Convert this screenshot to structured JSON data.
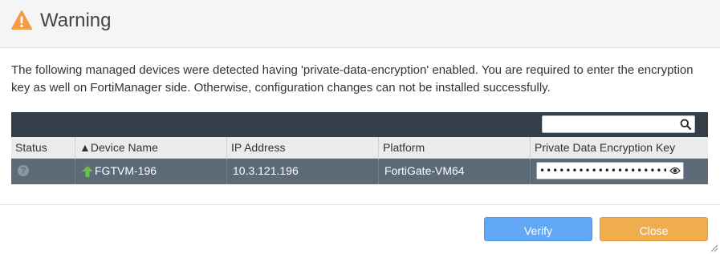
{
  "dialog": {
    "title": "Warning",
    "message": "The following managed devices were detected having 'private-data-encryption' enabled. You are required to enter the encryption key as well on FortiManager side. Otherwise, configuration changes can not be installed successfully."
  },
  "grid": {
    "search": {
      "value": "",
      "placeholder": ""
    },
    "columns": [
      {
        "label": "Status"
      },
      {
        "label": "▲Device Name"
      },
      {
        "label": "IP Address"
      },
      {
        "label": "Platform"
      },
      {
        "label": "Private Data Encryption Key"
      }
    ],
    "rows": [
      {
        "status_icon": "question-icon",
        "status_glyph": "?",
        "device_icon": "arrow-up-icon",
        "device_name": "FGTVM-196",
        "ip_address": "10.3.121.196",
        "platform": "FortiGate-VM64",
        "encryption_key": "••••••••••••••••••••"
      }
    ]
  },
  "buttons": {
    "verify": "Verify",
    "close": "Close"
  },
  "colors": {
    "warning_icon": "#f39c45",
    "toolbar": "#343e49",
    "selected_row": "#5d6a78",
    "verify_button": "#62a8f5",
    "close_button": "#f0ad4e",
    "arrow_up": "#6cc04a"
  }
}
